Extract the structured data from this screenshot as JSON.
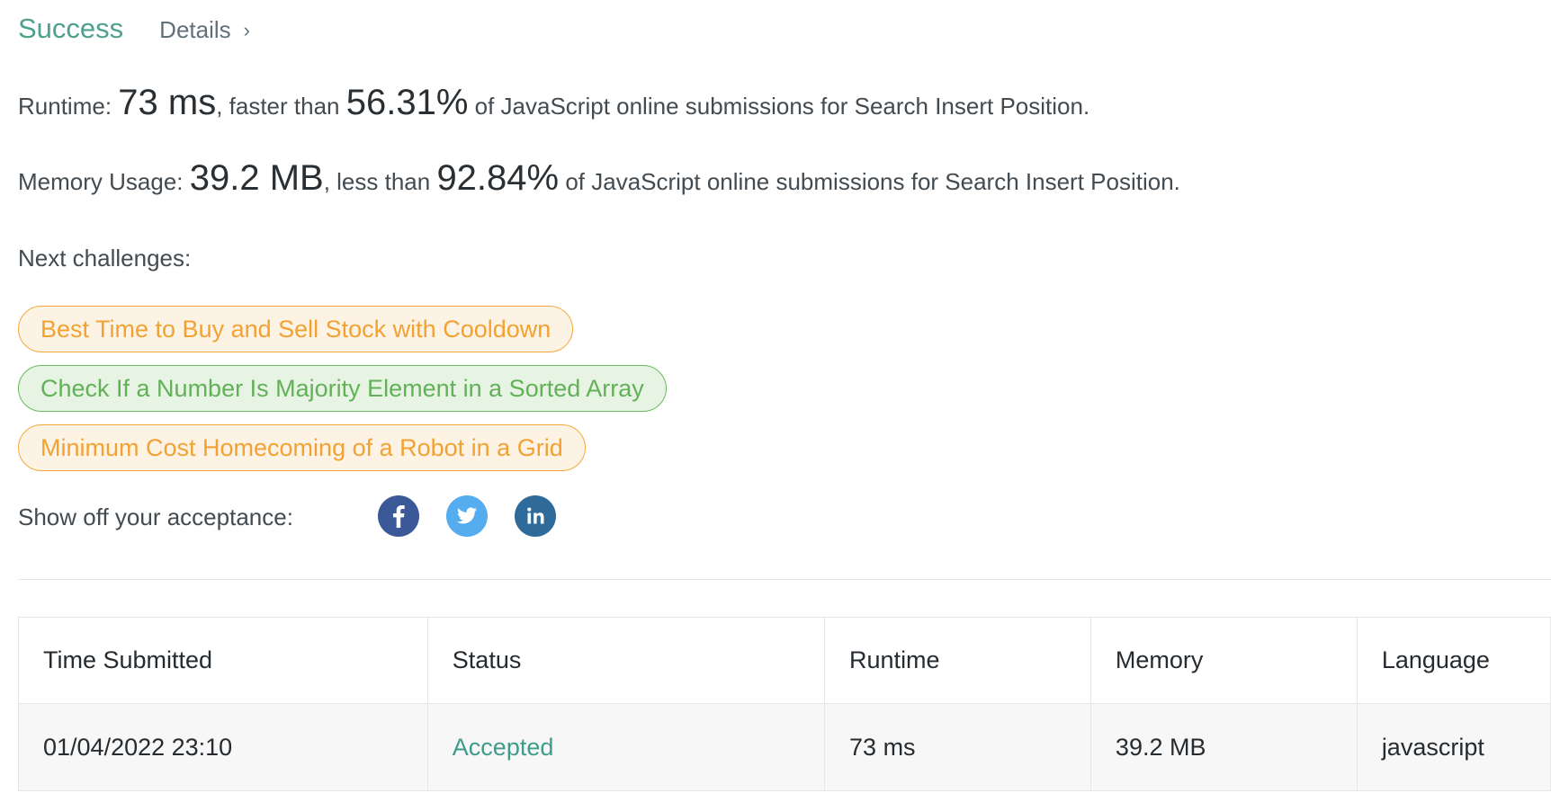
{
  "result": {
    "title": "Success",
    "details_label": "Details",
    "chevron": "›"
  },
  "runtime": {
    "label": "Runtime: ",
    "value": "73 ms",
    "comparison": ", faster than ",
    "percent": "56.31%",
    "suffix": " of JavaScript online submissions for Search Insert Position."
  },
  "memory": {
    "label": "Memory Usage: ",
    "value": "39.2 MB",
    "comparison": ", less than ",
    "percent": "92.84%",
    "suffix": " of JavaScript online submissions for Search Insert Position."
  },
  "next_challenges": {
    "label": "Next challenges:",
    "items": [
      {
        "title": "Best Time to Buy and Sell Stock with Cooldown",
        "difficulty": "medium",
        "color": "#f2a233"
      },
      {
        "title": "Check If a Number Is Majority Element in a Sorted Array",
        "difficulty": "easy",
        "color": "#62b159"
      },
      {
        "title": "Minimum Cost Homecoming of a Robot in a Grid",
        "difficulty": "medium",
        "color": "#f2a233"
      }
    ]
  },
  "share": {
    "label": "Show off your acceptance:",
    "networks": [
      {
        "icon": "facebook-icon",
        "color": "#3b5998"
      },
      {
        "icon": "twitter-icon",
        "color": "#55acee"
      },
      {
        "icon": "linkedin-icon",
        "color": "#2f6b9a"
      }
    ]
  },
  "submissions": {
    "columns": [
      "Time Submitted",
      "Status",
      "Runtime",
      "Memory",
      "Language"
    ],
    "rows": [
      {
        "time": "01/04/2022 23:10",
        "status": "Accepted",
        "runtime": "73 ms",
        "memory": "39.2 MB",
        "language": "javascript"
      }
    ]
  },
  "colors": {
    "success": "#4da18e",
    "accepted": "#3f9c8a",
    "medium": "#f2a233",
    "easy": "#62b159"
  }
}
